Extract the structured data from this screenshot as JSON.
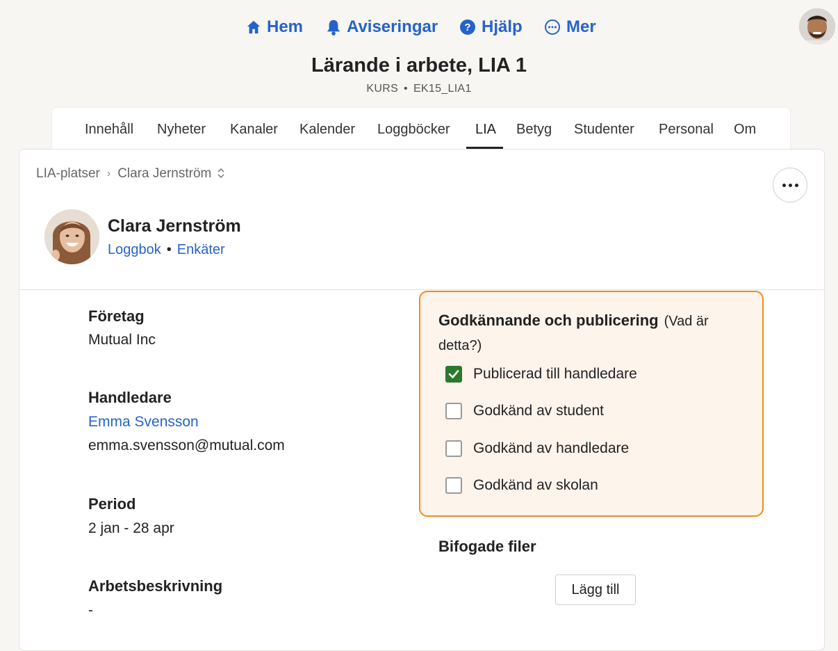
{
  "topnav": {
    "items": [
      {
        "label": "Hem",
        "icon": "home-icon"
      },
      {
        "label": "Aviseringar",
        "icon": "bell-icon"
      },
      {
        "label": "Hjälp",
        "icon": "help-icon"
      },
      {
        "label": "Mer",
        "icon": "more-circle-icon"
      }
    ]
  },
  "course": {
    "title": "Lärande i arbete, LIA 1",
    "type": "KURS",
    "code": "EK15_LIA1"
  },
  "tabs": [
    "Innehåll",
    "Nyheter",
    "Kanaler",
    "Kalender",
    "Loggböcker",
    "LIA",
    "Betyg",
    "Studenter",
    "Personal",
    "Om"
  ],
  "active_tab": "LIA",
  "breadcrumb": {
    "parent": "LIA-platser",
    "current": "Clara Jernström"
  },
  "student": {
    "name": "Clara Jernström",
    "link_logbook": "Loggbok",
    "link_surveys": "Enkäter"
  },
  "details": {
    "company_label": "Företag",
    "company_value": "Mutual Inc",
    "supervisor_label": "Handledare",
    "supervisor_name": "Emma Svensson",
    "supervisor_email": "emma.svensson@mutual.com",
    "period_label": "Period",
    "period_value": "2 jan - 28 apr",
    "description_label": "Arbetsbeskrivning",
    "description_value": "-"
  },
  "approval": {
    "title": "Godkännande och publicering",
    "help": "(Vad är detta?)",
    "items": [
      {
        "label": "Publicerad till handledare",
        "checked": true
      },
      {
        "label": "Godkänd av student",
        "checked": false
      },
      {
        "label": "Godkänd av handledare",
        "checked": false
      },
      {
        "label": "Godkänd av skolan",
        "checked": false
      }
    ]
  },
  "files": {
    "title": "Bifogade filer",
    "add_label": "Lägg till"
  },
  "colors": {
    "link": "#2563c9",
    "accent_border": "#f18a1e",
    "checked": "#2b7a2b",
    "approval_bg": "#fdf4ec"
  }
}
